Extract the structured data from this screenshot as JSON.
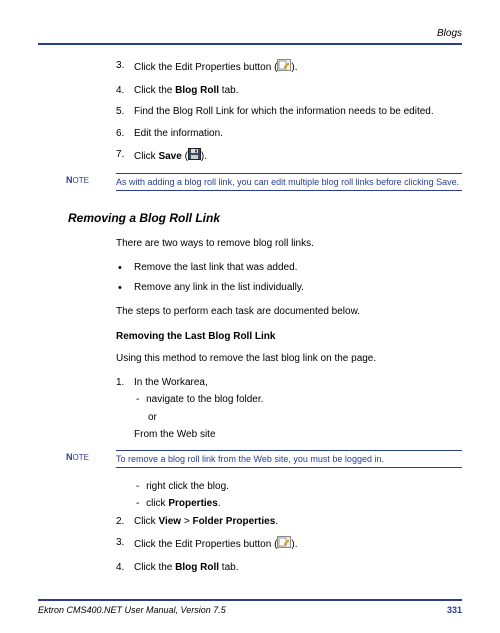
{
  "header": {
    "section": "Blogs"
  },
  "steps_top": [
    {
      "n": "3.",
      "html": "Click the Edit Properties button (__ICON_EDIT__)."
    },
    {
      "n": "4.",
      "html": "Click the <b>Blog Roll</b> tab."
    },
    {
      "n": "5.",
      "html": "Find the Blog Roll Link for which the information needs to be edited."
    },
    {
      "n": "6.",
      "html": "Edit the information."
    },
    {
      "n": "7.",
      "html": "Click <b>Save</b> (__ICON_SAVE__)."
    }
  ],
  "note1": {
    "label_initial": "N",
    "label_rest": "OTE",
    "text": "As with adding a blog roll link, you can edit multiple blog roll links before clicking Save."
  },
  "section_title": "Removing a Blog Roll Link",
  "intro": "There are two ways to remove blog roll links.",
  "bullets": [
    "Remove the last link that was added.",
    "Remove any link in the list individually."
  ],
  "after_bullets": "The steps to perform each task are documented below.",
  "subheading": "Removing the Last Blog Roll Link",
  "subintro": "Using this method to remove the last blog link on the page.",
  "steps_bottom_1": {
    "n": "1.",
    "text": "In the Workarea,",
    "sub1": "navigate to the blog folder.",
    "or": "or",
    "sub2": "From the Web site"
  },
  "note2": {
    "label_initial": "N",
    "label_rest": "OTE",
    "text": "To remove a blog roll link from the Web site, you must be logged in."
  },
  "steps_bottom_rest_subs": [
    "right click the blog.",
    "click <b>Properties</b>."
  ],
  "steps_bottom_rest": [
    {
      "n": "2.",
      "html": "Click <b>View</b> > <b>Folder Properties</b>."
    },
    {
      "n": "3.",
      "html": "Click the Edit Properties button (__ICON_EDIT__)."
    },
    {
      "n": "4.",
      "html": "Click the <b>Blog Roll</b> tab."
    }
  ],
  "footer": {
    "left": "Ektron CMS400.NET User Manual, Version 7.5",
    "page": "331"
  },
  "icons": {
    "edit": "edit-properties-icon",
    "save": "save-icon"
  }
}
